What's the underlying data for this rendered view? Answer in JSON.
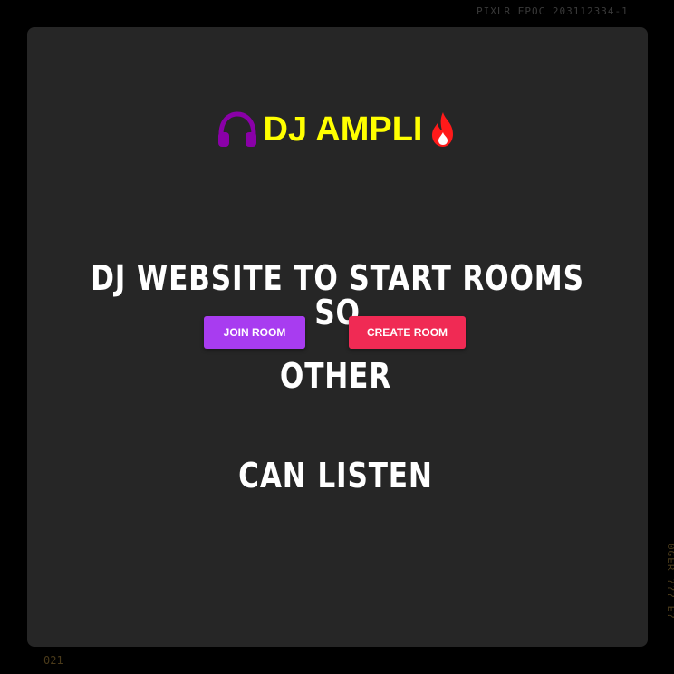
{
  "film": {
    "code_top": "PIXLR EPOC 203112334-1",
    "code_side": "0GER ??? E?",
    "code_bottom": "021"
  },
  "brand": {
    "title": "DJ AMPLI",
    "headphones_icon_color": "#8a00a8",
    "fire_icon_color": "#ff1a1a",
    "title_color": "#ffff00"
  },
  "hero": {
    "line1": "DJ WEBSITE TO START ROOMS SO",
    "line2": "OTHER",
    "line3": "CAN LISTEN"
  },
  "actions": {
    "join_label": "JOIN ROOM",
    "create_label": "CREATE ROOM",
    "join_color": "#a83cf0",
    "create_color": "#f02a54"
  },
  "colors": {
    "page_background": "#000000",
    "card_background": "#262626",
    "hero_text": "#ffffff"
  }
}
